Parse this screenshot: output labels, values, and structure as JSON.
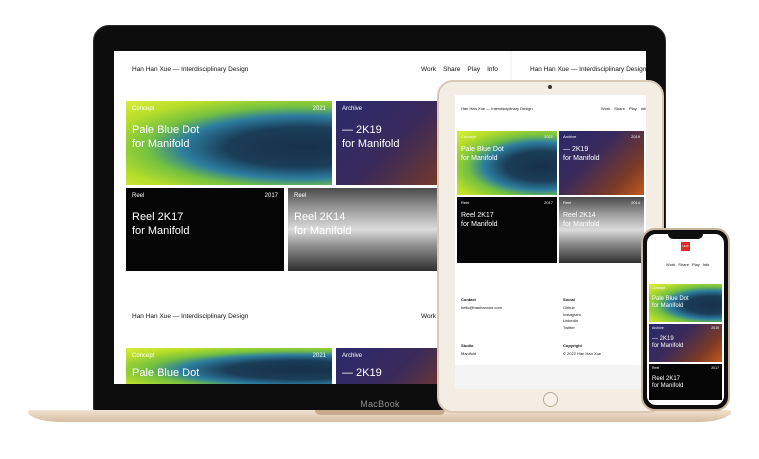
{
  "site": {
    "title": "Han Han Xue — Interdisciplinary Design",
    "nav": [
      "Work",
      "Share",
      "Play",
      "Info"
    ]
  },
  "cards": [
    {
      "tag": "Concept",
      "year": "2021",
      "title_line1": "Pale Blue Dot",
      "title_line2": "for Manifold"
    },
    {
      "tag": "Archive",
      "year": "2019",
      "title_line1": "— 2K19",
      "title_line2": "for Manifold"
    },
    {
      "tag": "Reel",
      "year": "2017",
      "title_line1": "Reel 2K17",
      "title_line2": "for Manifold"
    },
    {
      "tag": "Reel",
      "year": "2014",
      "title_line1": "Reel 2K14",
      "title_line2": "for Manifold"
    }
  ],
  "footer": {
    "contact_heading": "Contact",
    "contact_email": "hello@hanhanxue.com",
    "social_heading": "Social",
    "social_links": [
      "Github",
      "Instagram",
      "LinkedIn",
      "Twitter"
    ],
    "studio_heading": "Studio",
    "studio_value": "Manifold",
    "copyright_heading": "Copyright",
    "copyright_value": "© 2022 Han Han Xue"
  },
  "iphone_logo": "HHX",
  "device_label": "MacBook"
}
